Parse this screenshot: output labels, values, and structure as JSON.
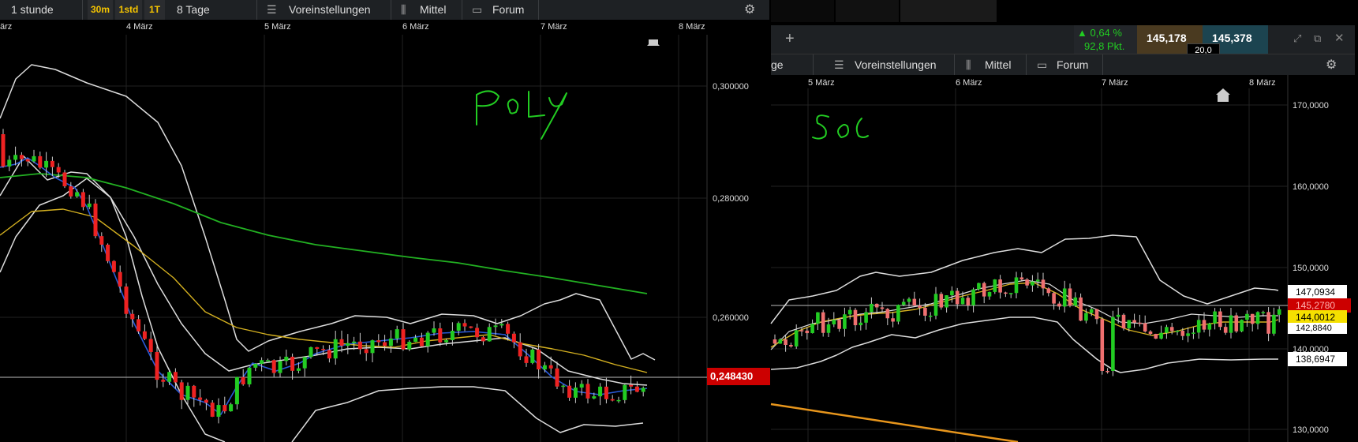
{
  "left": {
    "toolbar": {
      "period": "1 stunde",
      "timeframes": [
        "30m",
        "1std",
        "1T"
      ],
      "range": "8 Tage",
      "settings": "Voreinstellungen",
      "indicator": "Mittel",
      "forum": "Forum"
    },
    "dates": [
      "ärz",
      "4 März",
      "5 März",
      "6 März",
      "7 März",
      "8 März"
    ],
    "price_labels": [
      "0,300000",
      "0,280000",
      "0,260000"
    ],
    "current_price": "0,248430",
    "annotation": "PoLy"
  },
  "right": {
    "header": {
      "change_pct": "0,64 %",
      "change_pts": "92,8 Pkt.",
      "bid": "145,178",
      "ask": "145,378",
      "spread": "20,0"
    },
    "toolbar": {
      "tab_fragment": "ge",
      "settings": "Voreinstellungen",
      "indicator": "Mittel",
      "forum": "Forum"
    },
    "dates": [
      "5 März",
      "6 März",
      "7 März",
      "8 März"
    ],
    "price_labels": [
      "170,0000",
      "160,0000",
      "150,0000",
      "140,0000",
      "130,0000"
    ],
    "tags": [
      "147,0934",
      "145,2780",
      "144,0012",
      "142,8840",
      "138,6947"
    ],
    "annotation": "SoL"
  },
  "colors": {
    "up": "#22cc22",
    "down": "#ee2222",
    "bollinger": "#dddddd",
    "ma_yellow": "#d4b020",
    "ma_blue": "#2a5ad8",
    "ma_green": "#22b022",
    "accent": "#f5c400",
    "price_tag": "#cc0000",
    "handwriting": "#22cc22"
  },
  "chart_data": [
    {
      "type": "candlestick",
      "title": "PoLy",
      "y_ticks": [
        0.3,
        0.28,
        0.26
      ],
      "current": 0.24843,
      "x_ticks": [
        "4 März",
        "5 März",
        "6 März",
        "7 März",
        "8 März"
      ],
      "series": [
        {
          "name": "ma_long",
          "values": [
            0.282,
            0.2805,
            0.279,
            0.2775,
            0.276,
            0.2745,
            0.273,
            0.272,
            0.271,
            0.27,
            0.269,
            0.268,
            0.267,
            0.266,
            0.2648
          ]
        }
      ]
    },
    {
      "type": "candlestick",
      "title": "SoL",
      "y_ticks": [
        170,
        160,
        150,
        140,
        130
      ],
      "tags": [
        147.0934,
        145.278,
        144.0012,
        142.884,
        138.6947
      ]
    }
  ]
}
